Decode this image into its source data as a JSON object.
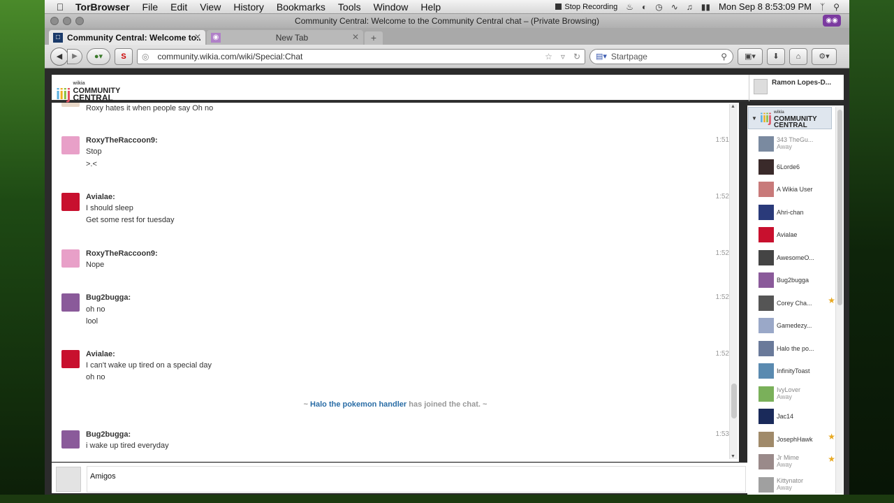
{
  "menubar": {
    "app": "TorBrowser",
    "items": [
      "File",
      "Edit",
      "View",
      "History",
      "Bookmarks",
      "Tools",
      "Window",
      "Help"
    ],
    "stop_recording": "Stop Recording",
    "datetime": "Mon Sep 8  8:53:09 PM"
  },
  "window": {
    "title": "Community Central: Welcome to the Community Central chat – (Private Browsing)"
  },
  "tabs": [
    {
      "label": "Community Central: Welcome to...",
      "active": true
    },
    {
      "label": "New Tab",
      "active": false
    }
  ],
  "navbar": {
    "url": "community.wikia.com/wiki/Special:Chat",
    "search_placeholder": "Startpage"
  },
  "header": {
    "logo_small": "wikia",
    "logo_line1": "COMMUNITY",
    "logo_line2": "CENTRAL",
    "username": "Ramon Lopes-D..."
  },
  "messages": [
    {
      "user": "",
      "lines": [
        "Roxy hates it when people say Oh no"
      ],
      "time": "",
      "avatar_color": "#e8d8c8"
    },
    {
      "user": "RoxyTheRaccoon9:",
      "lines": [
        "Stop",
        ">.<"
      ],
      "time": "1:51",
      "avatar_color": "#e8a0c8"
    },
    {
      "user": "Avialae:",
      "lines": [
        "I should sleep",
        "Get some rest for tuesday"
      ],
      "time": "1:52",
      "avatar_color": "#c8102e"
    },
    {
      "user": "RoxyTheRaccoon9:",
      "lines": [
        "Nope"
      ],
      "time": "1:52",
      "avatar_color": "#e8a0c8"
    },
    {
      "user": "Bug2bugga:",
      "lines": [
        "oh no",
        "lool"
      ],
      "time": "1:52",
      "avatar_color": "#8a5a9a"
    },
    {
      "user": "Avialae:",
      "lines": [
        "I can't wake up tired on a special day",
        "oh no"
      ],
      "time": "1:52",
      "avatar_color": "#c8102e"
    },
    {
      "user": "Bug2bugga:",
      "lines": [
        "i wake up tired everyday"
      ],
      "time": "1:53",
      "avatar_color": "#8a5a9a"
    }
  ],
  "joined": {
    "prefix": "~ ",
    "who": "Halo the pokemon handler",
    "suffix": " has joined the chat. ~"
  },
  "input": {
    "value": "Amigos"
  },
  "userlist": [
    {
      "name": "343 TheGu...",
      "away": "Away",
      "star": false,
      "color": "#7a8aa0"
    },
    {
      "name": "6Lorde6",
      "away": "",
      "star": false,
      "color": "#3a2a2a"
    },
    {
      "name": "A Wikia User",
      "away": "",
      "star": false,
      "color": "#c87a7a"
    },
    {
      "name": "Ahri-chan",
      "away": "",
      "star": false,
      "color": "#2a3a7a"
    },
    {
      "name": "Avialae",
      "away": "",
      "star": false,
      "color": "#c8102e"
    },
    {
      "name": "AwesomeO...",
      "away": "",
      "star": false,
      "color": "#444444"
    },
    {
      "name": "Bug2bugga",
      "away": "",
      "star": false,
      "color": "#8a5a9a"
    },
    {
      "name": "Corey Cha...",
      "away": "",
      "star": true,
      "color": "#555555"
    },
    {
      "name": "Gamedezy...",
      "away": "",
      "star": false,
      "color": "#9aa8c8"
    },
    {
      "name": "Halo the po...",
      "away": "",
      "star": false,
      "color": "#6a7a9a"
    },
    {
      "name": "InfinityToast",
      "away": "",
      "star": false,
      "color": "#5a8ab0"
    },
    {
      "name": "IvyLover",
      "away": "Away",
      "star": false,
      "color": "#7ab05a"
    },
    {
      "name": "Jac14",
      "away": "",
      "star": false,
      "color": "#1a2a5a"
    },
    {
      "name": "JosephHawk",
      "away": "",
      "star": true,
      "color": "#a08a6a"
    },
    {
      "name": "Jr Mime",
      "away": "Away",
      "star": true,
      "color": "#9a8a8a"
    },
    {
      "name": "Kittynator",
      "away": "Away",
      "star": false,
      "color": "#a0a0a0"
    }
  ]
}
